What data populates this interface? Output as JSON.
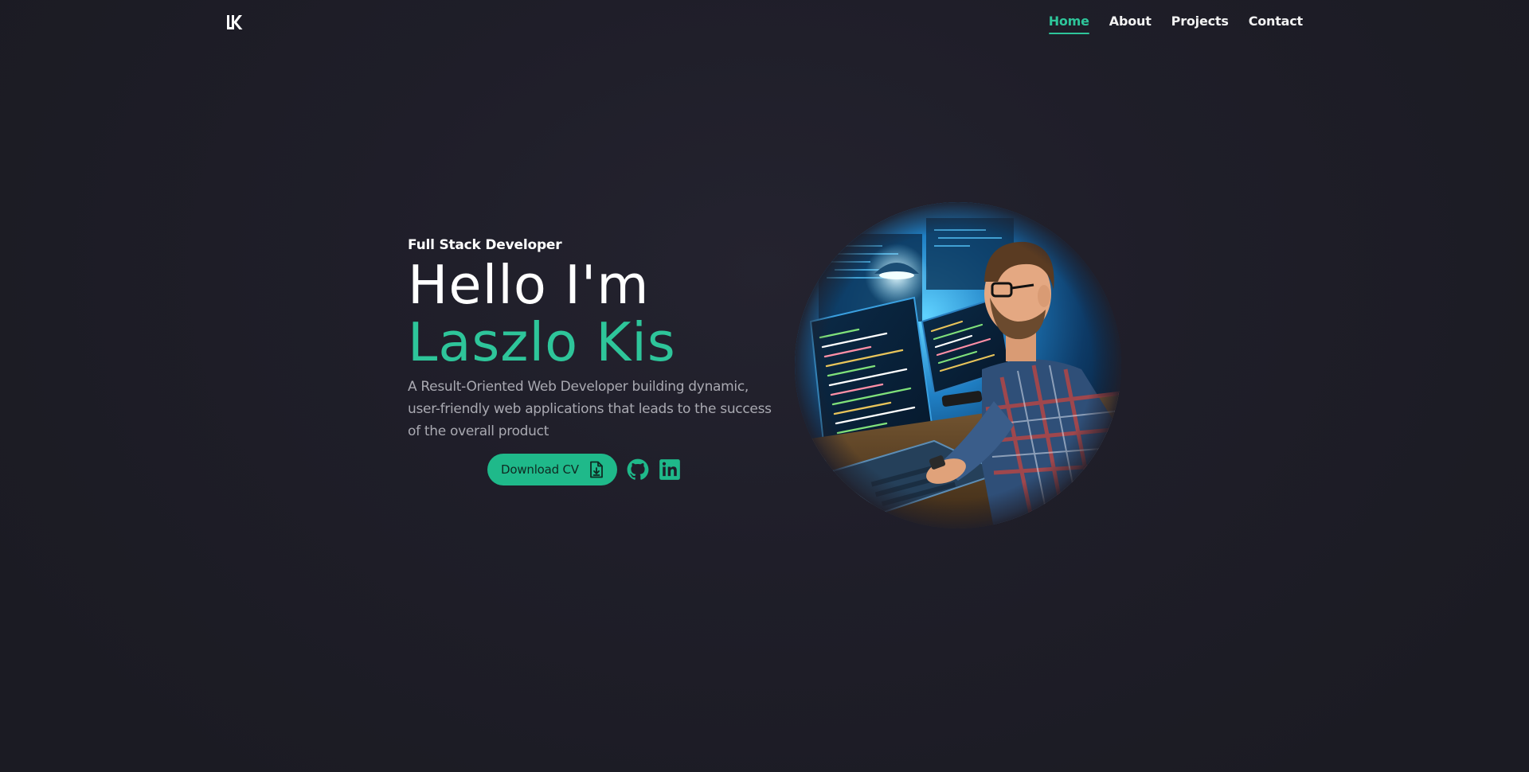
{
  "header": {
    "logo_icon": "lk-monogram-logo",
    "nav": [
      {
        "label": "Home",
        "active": true
      },
      {
        "label": "About",
        "active": false
      },
      {
        "label": "Projects",
        "active": false
      },
      {
        "label": "Contact",
        "active": false
      }
    ]
  },
  "hero": {
    "subtitle": "Full Stack Developer",
    "headline_line1": "Hello I'm",
    "headline_line2": "Laszlo Kis",
    "description": "A Result-Oriented Web Developer building dynamic, user-friendly web applications that leads to the success of the overall product",
    "download_label": "Download CV",
    "download_icon": "file-download-icon",
    "social": [
      {
        "icon": "github-icon"
      },
      {
        "icon": "linkedin-icon"
      }
    ],
    "portrait_icon": "developer-portrait-image"
  },
  "colors": {
    "accent": "#2ec59a",
    "button_bg": "#1fb98a",
    "background": "#1f1e29",
    "text": "#ffffff",
    "muted_text": "#a9a9b1"
  }
}
